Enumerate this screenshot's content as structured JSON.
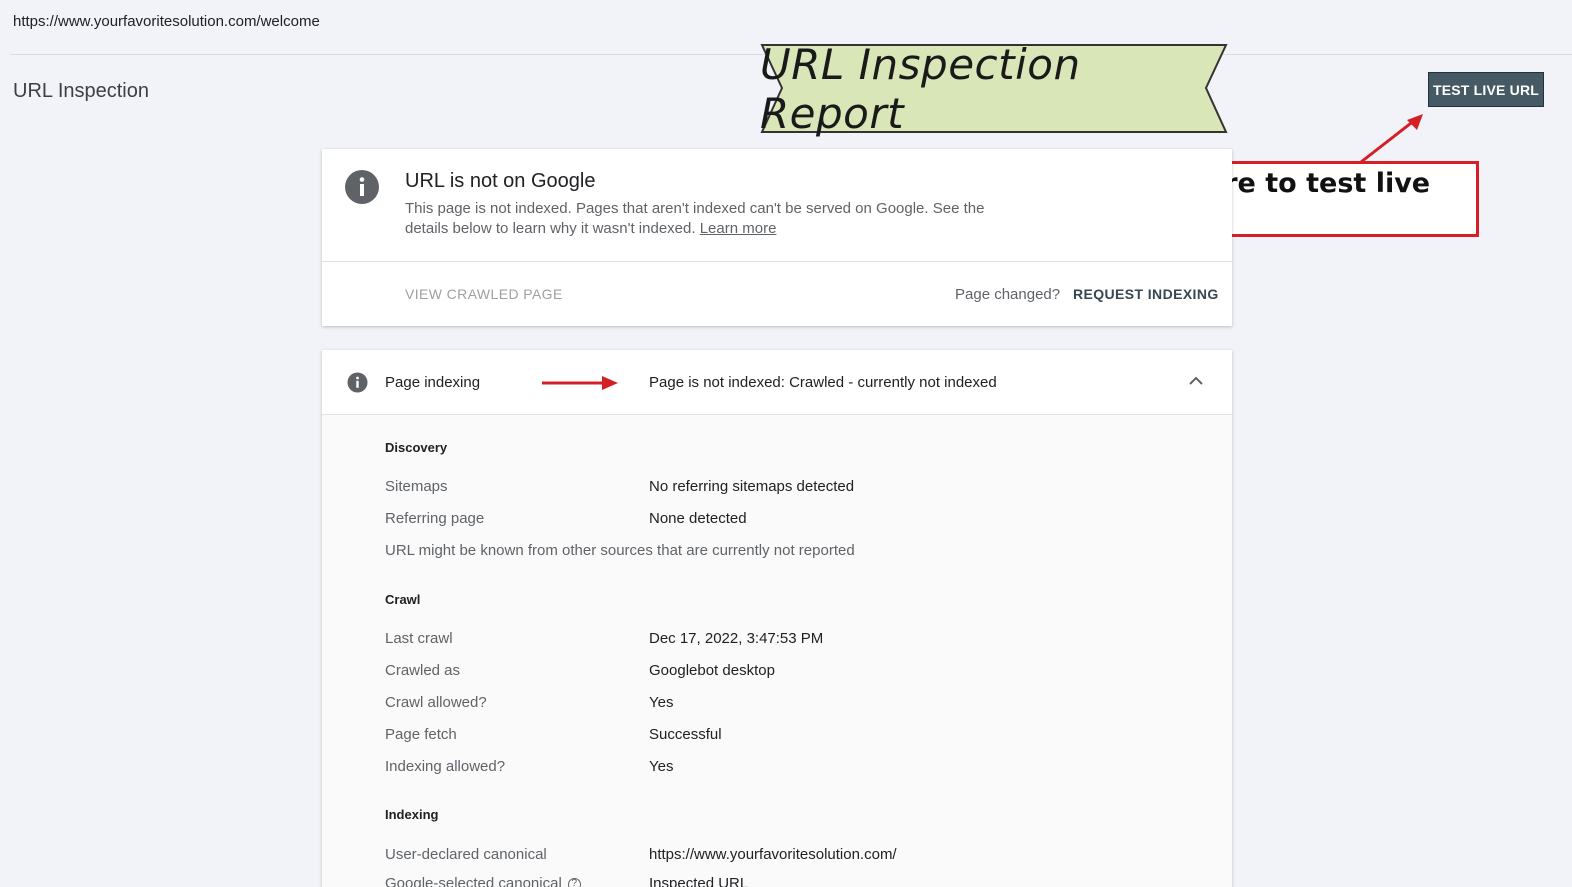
{
  "url_bar": {
    "url": "https://www.yourfavoritesolution.com/welcome"
  },
  "header": {
    "title": "URL Inspection",
    "test_live_label": "TEST LIVE URL"
  },
  "annotations": {
    "banner": "URL Inspection Report",
    "callout": "Click here to test live URL",
    "banner_color": "#d9e7b8",
    "callout_border_color": "#d51f27"
  },
  "status_card": {
    "title": "URL is not on Google",
    "description": "This page is not indexed. Pages that aren't indexed can't be served on Google. See the details below to learn why it wasn't indexed.",
    "learn_more": "Learn more",
    "view_crawled": "VIEW CRAWLED PAGE",
    "page_changed": "Page changed?",
    "request_indexing": "REQUEST INDEXING"
  },
  "indexing_card": {
    "label": "Page indexing",
    "status": "Page is not indexed: Crawled - currently not indexed",
    "discovery": {
      "title": "Discovery",
      "rows": [
        {
          "label": "Sitemaps",
          "value": "No referring sitemaps detected"
        },
        {
          "label": "Referring page",
          "value": "None detected"
        }
      ],
      "note": "URL might be known from other sources that are currently not reported"
    },
    "crawl": {
      "title": "Crawl",
      "rows": [
        {
          "label": "Last crawl",
          "value": "Dec 17, 2022, 3:47:53 PM"
        },
        {
          "label": "Crawled as",
          "value": "Googlebot desktop"
        },
        {
          "label": "Crawl allowed?",
          "value": "Yes"
        },
        {
          "label": "Page fetch",
          "value": "Successful"
        },
        {
          "label": "Indexing allowed?",
          "value": "Yes"
        }
      ]
    },
    "indexing": {
      "title": "Indexing",
      "rows": [
        {
          "label": "User-declared canonical",
          "value": "https://www.yourfavoritesolution.com/"
        },
        {
          "label": "Google-selected canonical",
          "value": "Inspected URL"
        }
      ]
    }
  }
}
